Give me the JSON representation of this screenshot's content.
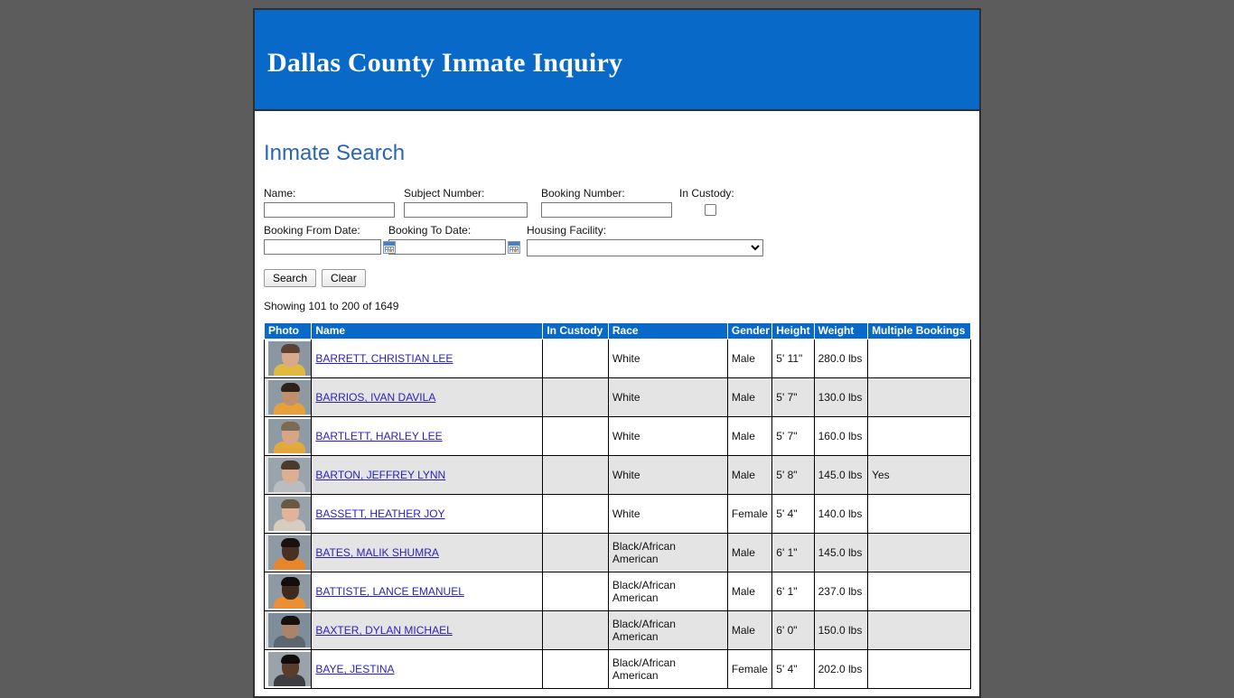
{
  "banner": {
    "title": "Dallas County Inmate Inquiry"
  },
  "section": {
    "title": "Inmate Search"
  },
  "colors": {
    "banner_blue": "#0969c8",
    "header_blue": "#0969c8",
    "link_blue": "#2a1fb8",
    "section_title_blue": "#2a66b5",
    "page_background": "#5c5c5c",
    "row_stripe": "#e4e4e4"
  },
  "search": {
    "name": {
      "label": "Name:",
      "value": "",
      "placeholder": ""
    },
    "subject_number": {
      "label": "Subject Number:",
      "value": "",
      "placeholder": ""
    },
    "booking_number": {
      "label": "Booking Number:",
      "value": "",
      "placeholder": ""
    },
    "in_custody": {
      "label": "In Custody:",
      "checked": false
    },
    "booking_from_date": {
      "label": "Booking From Date:",
      "value": "",
      "placeholder": ""
    },
    "booking_to_date": {
      "label": "Booking To Date:",
      "value": "",
      "placeholder": ""
    },
    "housing_facility": {
      "label": "Housing Facility:",
      "selected": "",
      "options": [
        ""
      ]
    },
    "search_button": "Search",
    "clear_button": "Clear"
  },
  "results": {
    "count_text": "Showing 101 to 200 of 1649",
    "columns": [
      "Photo",
      "Name",
      "In Custody",
      "Race",
      "Gender",
      "Height",
      "Weight",
      "Multiple Bookings"
    ],
    "rows": [
      {
        "name": "BARRETT, CHRISTIAN LEE",
        "in_custody": "",
        "race": "White",
        "gender": "Male",
        "height": "5' 11\"",
        "weight": "280.0 lbs",
        "multiple_bookings": "",
        "photo": {
          "bg": "#8a97a2",
          "skin": "#d9a98d",
          "hair": "#5b4333",
          "shirt": "#e0b93f"
        }
      },
      {
        "name": "BARRIOS, IVAN DAVILA",
        "in_custody": "",
        "race": "White",
        "gender": "Male",
        "height": "5' 7\"",
        "weight": "130.0 lbs",
        "multiple_bookings": "",
        "photo": {
          "bg": "#8d99a3",
          "skin": "#c08f6c",
          "hair": "#2e2118",
          "shirt": "#e8a13a"
        }
      },
      {
        "name": "BARTLETT, HARLEY LEE",
        "in_custody": "",
        "race": "White",
        "gender": "Male",
        "height": "5' 7\"",
        "weight": "160.0 lbs",
        "multiple_bookings": "",
        "photo": {
          "bg": "#8e9aa4",
          "skin": "#d6a585",
          "hair": "#7c6a52",
          "shirt": "#e4a93c"
        }
      },
      {
        "name": "BARTON, JEFFREY LYNN",
        "in_custody": "",
        "race": "White",
        "gender": "Male",
        "height": "5' 8\"",
        "weight": "145.0 lbs",
        "multiple_bookings": "Yes",
        "photo": {
          "bg": "#9aa4ad",
          "skin": "#dcae92",
          "hair": "#4a3a2b",
          "shirt": "#b9bdc2"
        }
      },
      {
        "name": "BASSETT, HEATHER JOY",
        "in_custody": "",
        "race": "White",
        "gender": "Female",
        "height": "5' 4\"",
        "weight": "140.0 lbs",
        "multiple_bookings": "",
        "photo": {
          "bg": "#97a2ab",
          "skin": "#e0b49a",
          "hair": "#6b5842",
          "shirt": "#d7ccc0"
        }
      },
      {
        "name": "BATES, MALIK SHUMRA",
        "in_custody": "",
        "race": "Black/African American",
        "gender": "Male",
        "height": "6' 1\"",
        "weight": "145.0 lbs",
        "multiple_bookings": "",
        "photo": {
          "bg": "#8e9aa3",
          "skin": "#4a3024",
          "hair": "#1b120d",
          "shirt": "#e8862c"
        }
      },
      {
        "name": "BATTISTE, LANCE EMANUEL",
        "in_custody": "",
        "race": "Black/African American",
        "gender": "Male",
        "height": "6' 1\"",
        "weight": "237.0 lbs",
        "multiple_bookings": "",
        "photo": {
          "bg": "#8e9aa3",
          "skin": "#3e2a1e",
          "hair": "#140d09",
          "shirt": "#ec8f33"
        }
      },
      {
        "name": "BAXTER, DYLAN MICHAEL",
        "in_custody": "",
        "race": "Black/African American",
        "gender": "Male",
        "height": "6' 0\"",
        "weight": "150.0 lbs",
        "multiple_bookings": "",
        "photo": {
          "bg": "#7d8d99",
          "skin": "#a9846a",
          "hair": "#17110c",
          "shirt": "#5b6670"
        }
      },
      {
        "name": "BAYE, JESTINA",
        "in_custody": "",
        "race": "Black/African American",
        "gender": "Female",
        "height": "5' 4\"",
        "weight": "202.0 lbs",
        "multiple_bookings": "",
        "photo": {
          "bg": "#9aa3ab",
          "skin": "#5a3c2c",
          "hair": "#120c09",
          "shirt": "#3d3d42"
        }
      }
    ]
  }
}
